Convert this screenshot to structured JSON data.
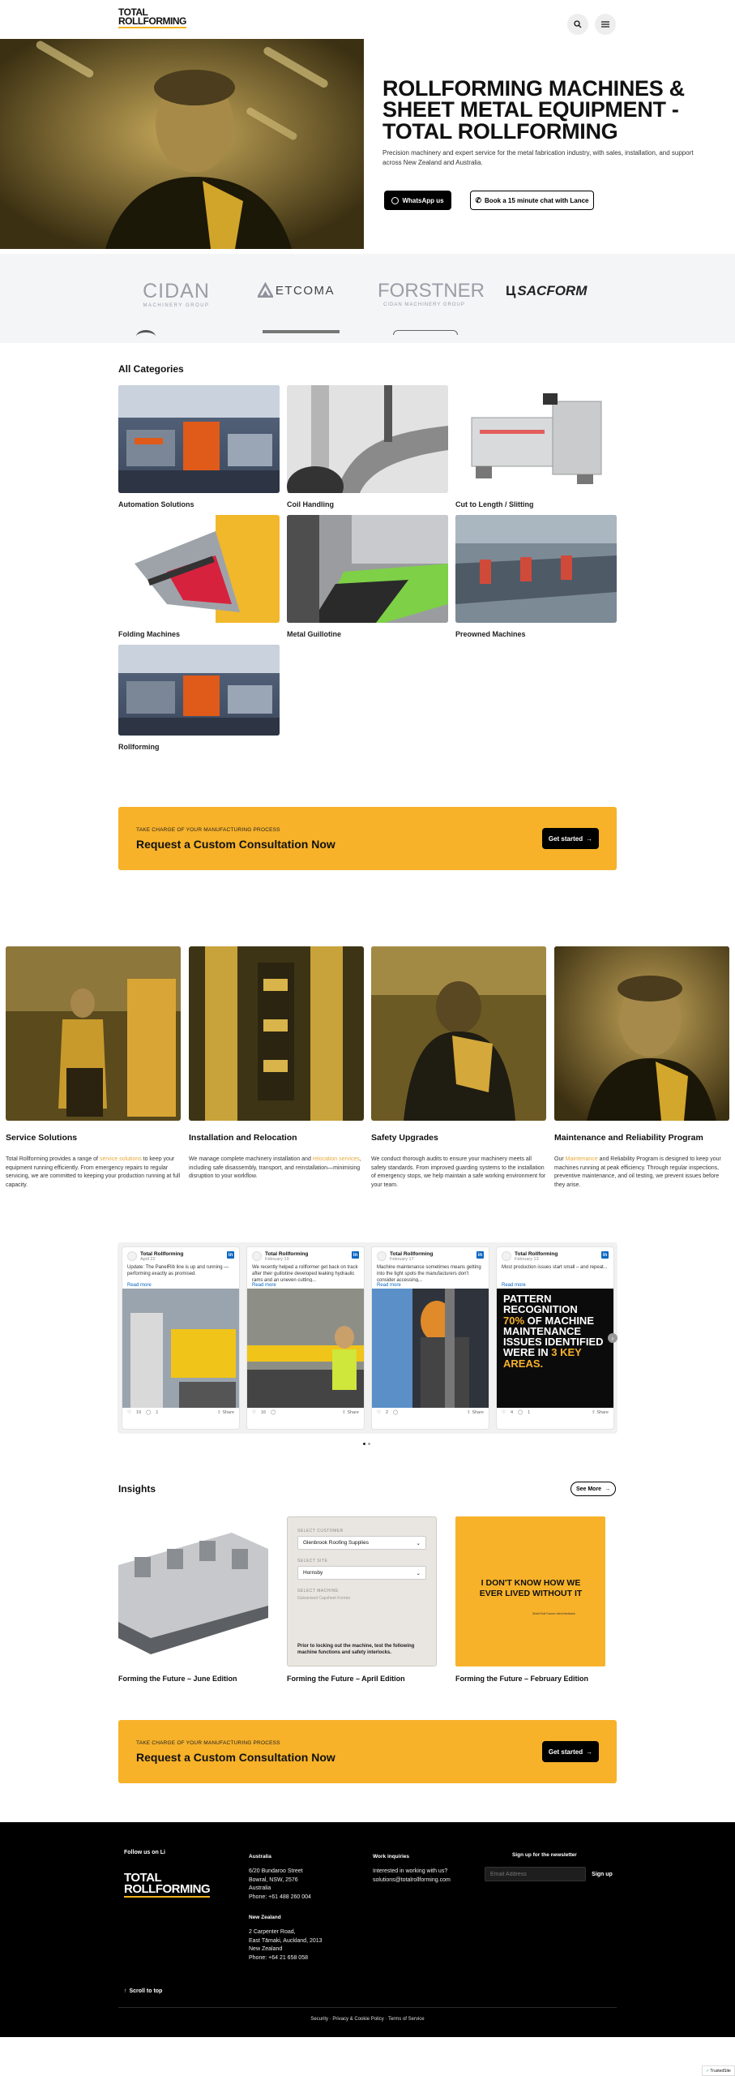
{
  "header": {
    "logo_line1": "TOTAL",
    "logo_line2": "ROLLFORMING"
  },
  "hero": {
    "title": "ROLLFORMING MACHINES & SHEET METAL EQUIPMENT - TOTAL ROLLFORMING",
    "subtitle": "Precision machinery and expert service for the metal fabrication industry, with sales, installation, and support across New Zealand and Australia.",
    "whatsapp_label": "WhatsApp us",
    "book_label": "Book a 15 minute chat with Lance"
  },
  "brands": [
    "CIDAN",
    "ETCOMA",
    "FORSTNER",
    "SACFORM"
  ],
  "brand_sublabels": [
    "MACHINERY GROUP",
    "",
    "CIDAN MACHINERY GROUP",
    ""
  ],
  "categories": {
    "heading": "All Categories",
    "items": [
      "Automation Solutions",
      "Coil Handling",
      "Cut to Length / Slitting",
      "Folding Machines",
      "Metal Guillotine",
      "Preowned Machines",
      "Rollforming"
    ]
  },
  "cta1": {
    "small": "TAKE CHARGE OF YOUR MANUFACTURING PROCESS",
    "big": "Request a Custom Consultation Now",
    "button": "Get started"
  },
  "services": [
    {
      "title": "Service Solutions",
      "pre": "Total Rollforming provides a range of ",
      "link": "service solutions",
      "post": " to keep your equipment running efficiently. From emergency repairs to regular servicing, we are committed to keeping your production running at full capacity."
    },
    {
      "title": "Installation and Relocation",
      "pre": "We manage complete machinery installation and ",
      "link": "relocation services",
      "post": ", including safe disassembly, transport, and reinstallation—minimising disruption to your workflow."
    },
    {
      "title": "Safety Upgrades",
      "pre": "We conduct thorough audits to ensure your machinery meets all safety standards. From improved guarding systems to the installation of emergency stops, we help maintain a safe working environment for your team.",
      "link": "",
      "post": ""
    },
    {
      "title": "Maintenance and Reliability Program",
      "pre": "Our ",
      "link": "Maintenance",
      "post": " and Reliability Program is designed to keep your machines running at peak efficiency. Through regular inspections, preventive maintenance, and oil testing, we prevent issues before they arise."
    }
  ],
  "linkedin": [
    {
      "name": "Total Rollforming",
      "date": "April 22",
      "text": "Update: The PanelRib line is up and running — performing exactly as promised.",
      "more": "Read more",
      "likes": "19",
      "comments": "1",
      "share": "Share"
    },
    {
      "name": "Total Rollforming",
      "date": "February 19",
      "text": "We recently helped a rollformer get back on track after their guillotine developed leaking hydraulic rams and an uneven cutting...",
      "more": "Read more",
      "likes": "16",
      "comments": "",
      "share": "Share"
    },
    {
      "name": "Total Rollforming",
      "date": "February 17",
      "text": "Machine maintenance sometimes means getting into the tight spots the manufacturers don't consider accessing...",
      "more": "Read more",
      "likes": "2",
      "comments": "",
      "share": "Share"
    },
    {
      "name": "Total Rollforming",
      "date": "February 13",
      "text": "Most production issues start small – and repeat...",
      "more": "Read more",
      "likes": "4",
      "comments": "1",
      "share": "Share",
      "poster_lines": [
        "PATTERN",
        "RECOGNITION"
      ],
      "poster_pct": "70%",
      "poster_mid": [
        "OF MACHINE",
        "MAINTENANCE",
        "ISSUES IDENTIFIED",
        "WERE IN"
      ],
      "poster_end": "3 KEY",
      "poster_last": "AREAS."
    }
  ],
  "insights": {
    "heading": "Insights",
    "see_more": "See More",
    "items": [
      "Forming the Future – June Edition",
      "Forming the Future – April Edition",
      "Forming the Future – February Edition"
    ],
    "form_mock": {
      "label1": "SELECT CUSTOMER",
      "value1": "Glenbrook Roofing Supplies",
      "label2": "SELECT SITE",
      "value2": "Hornsby",
      "label3": "SELECT MACHINE",
      "value3": "Galvanised Capsheet Former",
      "note": "Prior to locking out the machine, test the following machine functions and safety interlocks."
    },
    "quote": "I DON'T KNOW HOW WE EVER LIVED WITHOUT IT",
    "quote_sub": "Sheet Roll Former client feedback"
  },
  "cta2": {
    "small": "TAKE CHARGE OF YOUR MANUFACTURING PROCESS",
    "big": "Request a Custom Consultation Now",
    "button": "Get started"
  },
  "footer": {
    "follow": "Follow us on Li",
    "australia_h": "Australia",
    "australia_lines": [
      "6/20 Bundaroo Street",
      "Bowral, NSW, 2576",
      "Australia",
      "Phone: +61 488 260 004"
    ],
    "nz_h": "New Zealand",
    "nz_lines": [
      "2 Carpenter Road,",
      "East Tāmaki, Auckland, 2013",
      "New Zealand",
      "Phone: +64 21 658 058"
    ],
    "work_h": "Work inquiries",
    "work_lines": [
      "Interested in working with us?",
      "solutions@totalrollforming.com"
    ],
    "newsletter_h": "Sign up for the newsletter",
    "email_placeholder": "Email Address",
    "signup": "Sign up",
    "scroll_top": "Scroll to top",
    "legal": [
      "Security",
      "Privacy & Cookie Policy",
      "Terms of Service"
    ],
    "trusted": "TrustedSite"
  },
  "colors": {
    "accent": "#f7b22a",
    "footer_bg": "#000000",
    "link": "#0a66c2"
  }
}
